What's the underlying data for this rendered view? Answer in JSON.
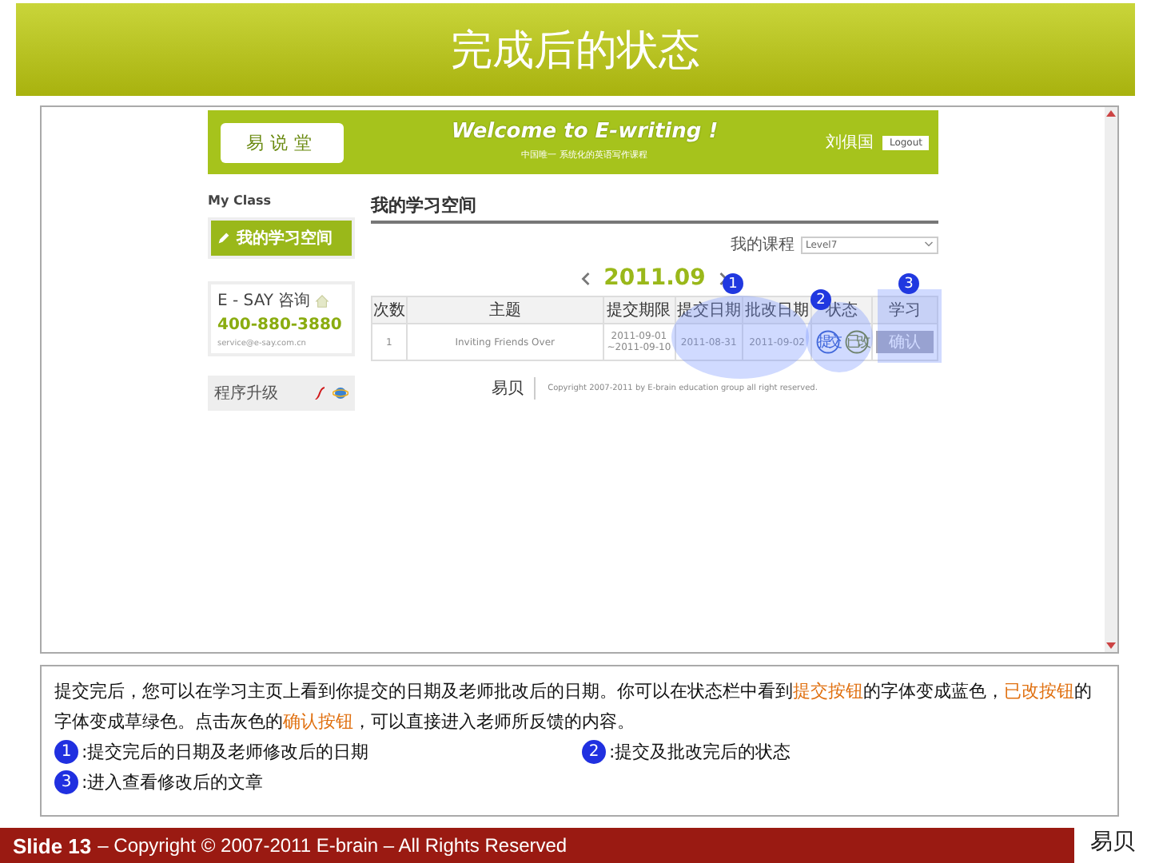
{
  "slide_title": "完成后的状态",
  "screenshot": {
    "header": {
      "logo": "易说堂",
      "banner_title": "Welcome to E-writing !",
      "banner_subtitle": "中国唯一 系统化的英语写作课程",
      "user_name": "刘俱国",
      "logout": "Logout"
    },
    "sidebar": {
      "heading": "My Class",
      "menu_item": "我的学习空间",
      "contact_title": "E - SAY 咨询",
      "phone": "400-880-3880",
      "email": "service@e-say.com.cn",
      "upgrade": "程序升级"
    },
    "main": {
      "heading": "我的学习空间",
      "course_label": "我的课程",
      "course_value": "Level7",
      "month": "2011.09",
      "columns": [
        "次数",
        "主题",
        "提交期限",
        "提交日期",
        "批改日期",
        "状态",
        "学习"
      ],
      "rows": [
        {
          "number": "1",
          "topic": "Inviting Friends Over",
          "deadline": [
            "2011-09-01",
            "~2011-09-10"
          ],
          "submitted": "2011-08-31",
          "corrected": "2011-09-02",
          "status": [
            {
              "label": "提交",
              "kind": "submitted"
            },
            {
              "label": "已改",
              "kind": "corrected"
            }
          ],
          "action": "确认"
        }
      ],
      "markers": [
        "1",
        "2",
        "3"
      ],
      "footer_logo": "易贝",
      "copyright": "Copyright 2007-2011 by E-brain education group all right reserved."
    }
  },
  "description": {
    "paragraph": [
      {
        "text": "提交完后，您可以在学习主页上看到你提交的日期及老师批改后的日期。你可以在状态栏中看到",
        "highlight": false
      },
      {
        "text": "提交按钮",
        "highlight": true
      },
      {
        "text": "的字体变成蓝色，",
        "highlight": false
      },
      {
        "text": "已改按钮",
        "highlight": true
      },
      {
        "text": "的字体变成草绿色。点击灰色的",
        "highlight": false
      },
      {
        "text": "确认按钮",
        "highlight": true
      },
      {
        "text": "，可以直接进入老师所反馈的内容。",
        "highlight": false
      }
    ],
    "legend": [
      {
        "number": "1",
        "text": ":提交完后的日期及老师修改后的日期"
      },
      {
        "number": "2",
        "text": ":提交及批改完后的状态"
      },
      {
        "number": "3",
        "text": ":进入查看修改后的文章"
      }
    ]
  },
  "footer": {
    "slide": "Slide 13",
    "copyright": "– Copyright © 2007-2011 E-brain – All Rights Reserved",
    "logo": "易贝"
  }
}
